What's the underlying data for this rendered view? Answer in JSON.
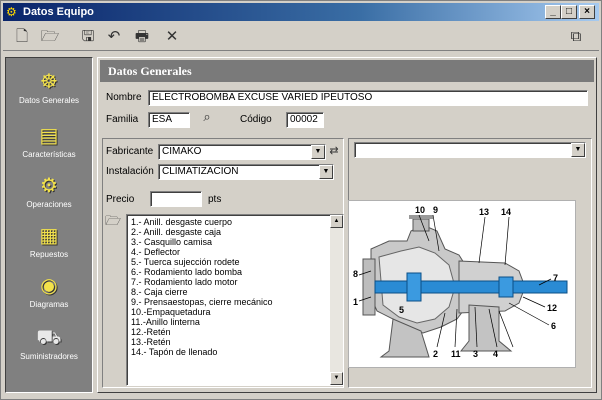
{
  "window": {
    "title": "Datos Equipo"
  },
  "toolbar": {
    "tools": [
      {
        "name": "new-icon",
        "glyph": "🗋"
      },
      {
        "name": "open-icon",
        "glyph": "🗁"
      },
      {
        "name": "save-icon",
        "glyph": "🖫"
      },
      {
        "name": "undo-icon",
        "glyph": "↶"
      },
      {
        "name": "print-icon",
        "glyph": "🖶"
      },
      {
        "name": "delete-icon",
        "glyph": "✕"
      },
      {
        "name": "copy-icon",
        "glyph": "⧉"
      }
    ]
  },
  "sidebar": {
    "items": [
      {
        "label": "Datos Generales",
        "icon": "ship-wheel-icon"
      },
      {
        "label": "Características",
        "icon": "document-icon"
      },
      {
        "label": "Operaciones",
        "icon": "gear-icon"
      },
      {
        "label": "Repuestos",
        "icon": "parts-icon"
      },
      {
        "label": "Diagramas",
        "icon": "diagram-icon"
      },
      {
        "label": "Suministradores",
        "icon": "truck-icon"
      }
    ]
  },
  "header": {
    "section": "Datos Generales"
  },
  "form": {
    "nombre_label": "Nombre",
    "nombre_value": "ELECTROBOMBA EXCUSE VARIED IPEUTOSO",
    "familia_label": "Familia",
    "familia_value": "ESA",
    "codigo_label": "Código",
    "codigo_value": "00002",
    "fabricante_label": "Fabricante",
    "fabricante_value": "CIMAKO",
    "instalacion_label": "Instalación",
    "instalacion_value": "CLIMATIZACION",
    "precio_label": "Precio",
    "precio_value": "",
    "precio_unit": "pts",
    "right_combo_value": ""
  },
  "parts_list": [
    "1.- Anill. desgaste cuerpo",
    "2.- Anill. desgaste caja",
    "3.- Casquillo camisa",
    "4.- Deflector",
    "5.- Tuerca sujección rodete",
    "6.- Rodamiento lado bomba",
    "7.- Rodamiento lado motor",
    "8.- Caja cierre",
    "9.- Prensaestopas, cierre mecánico",
    "10.-Empaquetadura",
    "11.-Anillo linterna",
    "12.-Retén",
    "13.-Retén",
    "14.- Tapón de llenado"
  ],
  "diagram": {
    "labels": [
      "10",
      "9",
      "13",
      "14",
      "8",
      "7",
      "1",
      "12",
      "5",
      "2",
      "6",
      "11",
      "3",
      "4"
    ],
    "shaft_color": "#2a8bd4"
  }
}
